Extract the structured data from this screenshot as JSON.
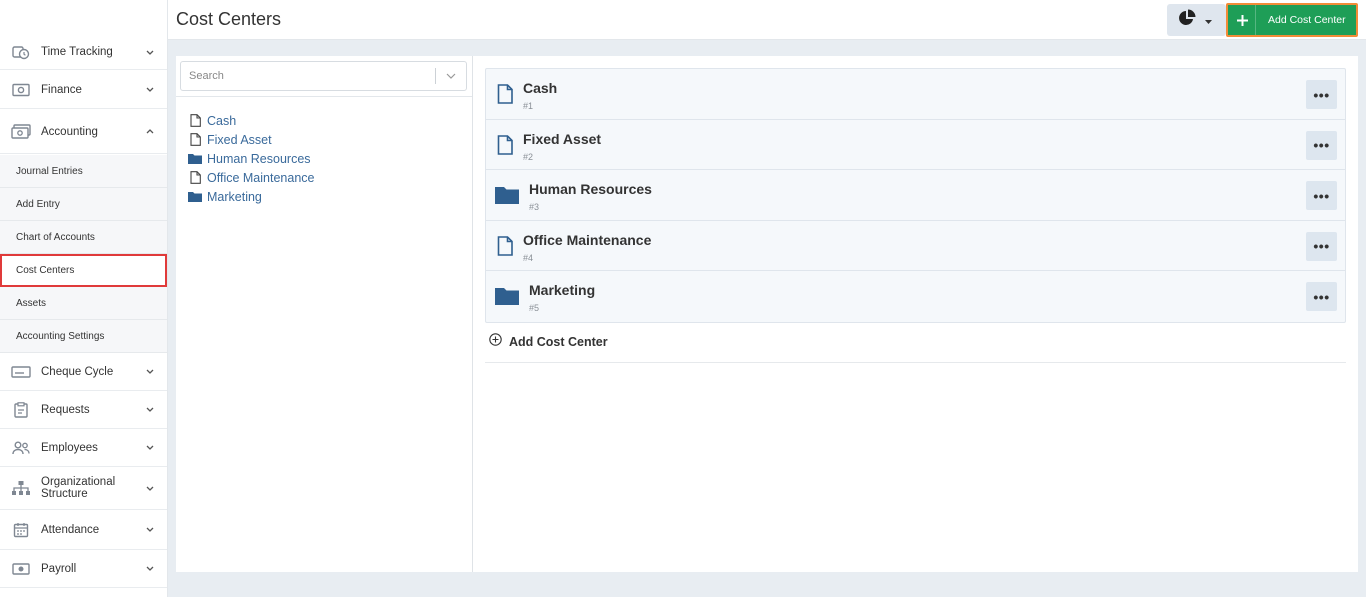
{
  "topbar": {
    "title": "Cost Centers",
    "add_button_label": "Add Cost Center"
  },
  "sidebar": {
    "top_items": [
      {
        "label": "Time Tracking",
        "icon": "clock-icon"
      },
      {
        "label": "Finance",
        "icon": "money-icon"
      },
      {
        "label": "Accounting",
        "icon": "cash-icon",
        "expanded": true
      }
    ],
    "accounting_subitems": [
      {
        "label": "Journal Entries"
      },
      {
        "label": "Add Entry"
      },
      {
        "label": "Chart of Accounts"
      },
      {
        "label": "Cost Centers",
        "active": true
      },
      {
        "label": "Assets"
      },
      {
        "label": "Accounting Settings"
      }
    ],
    "bottom_items": [
      {
        "label": "Cheque Cycle",
        "icon": "cheque-icon"
      },
      {
        "label": "Requests",
        "icon": "clipboard-icon"
      },
      {
        "label": "Employees",
        "icon": "people-icon"
      },
      {
        "label": "Organizational Structure",
        "icon": "org-chart-icon"
      },
      {
        "label": "Attendance",
        "icon": "calendar-icon"
      },
      {
        "label": "Payroll",
        "icon": "payroll-icon"
      }
    ]
  },
  "search": {
    "placeholder": "Search"
  },
  "tree": [
    {
      "label": "Cash",
      "type": "file"
    },
    {
      "label": "Fixed Asset",
      "type": "file"
    },
    {
      "label": "Human Resources",
      "type": "folder"
    },
    {
      "label": "Office Maintenance",
      "type": "file"
    },
    {
      "label": "Marketing",
      "type": "folder"
    }
  ],
  "cost_centers": [
    {
      "name": "Cash",
      "number": "#1",
      "type": "file"
    },
    {
      "name": "Fixed Asset",
      "number": "#2",
      "type": "file"
    },
    {
      "name": "Human Resources",
      "number": "#3",
      "type": "folder"
    },
    {
      "name": "Office Maintenance",
      "number": "#4",
      "type": "file"
    },
    {
      "name": "Marketing",
      "number": "#5",
      "type": "folder"
    }
  ],
  "more_label": "•••",
  "add_link_label": "Add Cost Center",
  "colors": {
    "accent_green": "#1e9e57",
    "folder_blue": "#2f5f8f",
    "link_blue": "#3a6a9b",
    "active_border": "#e03a3a",
    "highlight_orange": "#f28c38"
  }
}
